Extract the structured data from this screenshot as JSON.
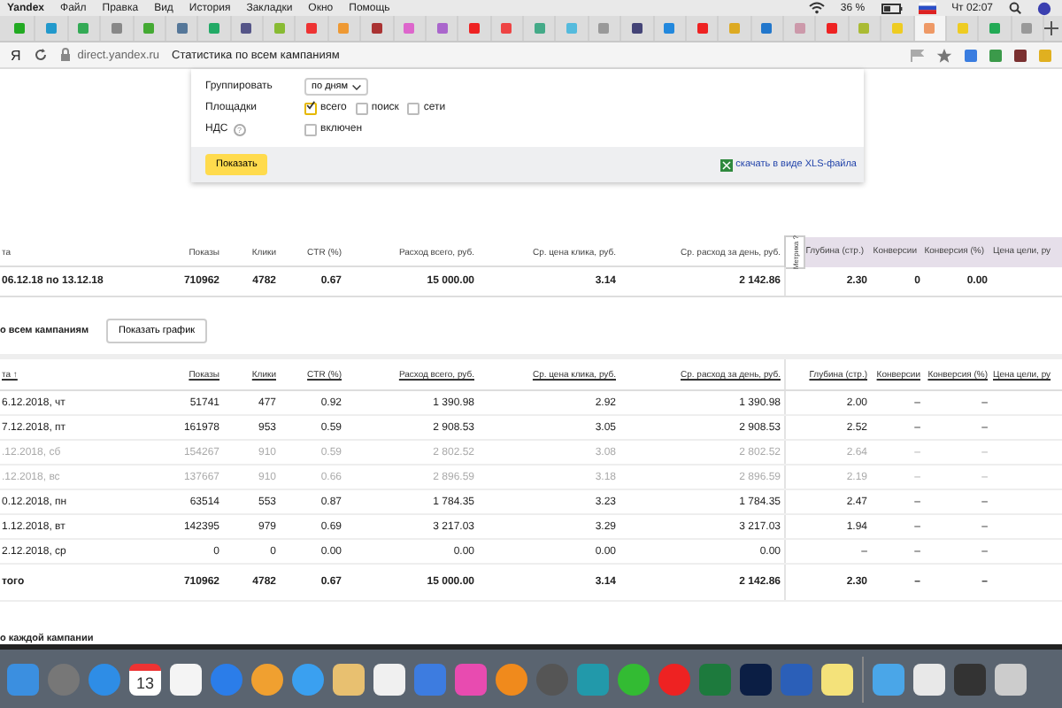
{
  "menu_bar": {
    "app": "Yandex",
    "items": [
      "Файл",
      "Правка",
      "Вид",
      "История",
      "Закладки",
      "Окно",
      "Помощь"
    ],
    "battery": "36 %",
    "clock": "Чт 02:07"
  },
  "address_bar": {
    "logo": "Я",
    "url": "direct.yandex.ru",
    "page_title": "Статистика по всем кампаниям"
  },
  "filter_form": {
    "group_label": "Группировать",
    "group_value": "по дням",
    "sites_label": "Площадки",
    "sites": [
      {
        "label": "всего",
        "checked": true
      },
      {
        "label": "поиск",
        "checked": false
      },
      {
        "label": "сети",
        "checked": false
      }
    ],
    "vat_label": "НДС",
    "vat_help": "?",
    "vat": {
      "label": "включен",
      "checked": false
    },
    "submit": "Показать",
    "download_link": "скачать в виде XLS-файла"
  },
  "summary_table": {
    "columns": [
      "та",
      "Показы",
      "Клики",
      "CTR (%)",
      "Расход всего, руб.",
      "Ср. цена клика, руб.",
      "Ср. расход за день, руб.",
      "Глубина (стр.)",
      "Конверсии",
      "Конверсия (%)",
      "Цена цели, ру"
    ],
    "metrika_tab": "Метрика ?",
    "rows": [
      [
        "06.12.18 по 13.12.18",
        "710962",
        "4782",
        "0.67",
        "15 000.00",
        "3.14",
        "2 142.86",
        "2.30",
        "0",
        "0.00"
      ]
    ]
  },
  "all_campaigns": {
    "heading": "о всем кампаниям",
    "chart_button": "Показать график"
  },
  "daily_table": {
    "columns": [
      "та ↑",
      "Показы",
      "Клики",
      "CTR (%)",
      "Расход всего, руб.",
      "Ср. цена клика, руб.",
      "Ср. расход за день, руб.",
      "Глубина (стр.)",
      "Конверсии",
      "Конверсия (%)",
      "Цена цели, ру"
    ],
    "rows": [
      {
        "muted": false,
        "cells": [
          "6.12.2018, чт",
          "51741",
          "477",
          "0.92",
          "1 390.98",
          "2.92",
          "1 390.98",
          "2.00",
          "–",
          "–"
        ]
      },
      {
        "muted": false,
        "cells": [
          "7.12.2018, пт",
          "161978",
          "953",
          "0.59",
          "2 908.53",
          "3.05",
          "2 908.53",
          "2.52",
          "–",
          "–"
        ]
      },
      {
        "muted": true,
        "cells": [
          ".12.2018, сб",
          "154267",
          "910",
          "0.59",
          "2 802.52",
          "3.08",
          "2 802.52",
          "2.64",
          "–",
          "–"
        ]
      },
      {
        "muted": true,
        "cells": [
          ".12.2018, вс",
          "137667",
          "910",
          "0.66",
          "2 896.59",
          "3.18",
          "2 896.59",
          "2.19",
          "–",
          "–"
        ]
      },
      {
        "muted": false,
        "cells": [
          "0.12.2018, пн",
          "63514",
          "553",
          "0.87",
          "1 784.35",
          "3.23",
          "1 784.35",
          "2.47",
          "–",
          "–"
        ]
      },
      {
        "muted": false,
        "cells": [
          "1.12.2018, вт",
          "142395",
          "979",
          "0.69",
          "3 217.03",
          "3.29",
          "3 217.03",
          "1.94",
          "–",
          "–"
        ]
      },
      {
        "muted": false,
        "cells": [
          "2.12.2018, ср",
          "0",
          "0",
          "0.00",
          "0.00",
          "0.00",
          "0.00",
          "–",
          "–",
          "–"
        ]
      }
    ],
    "total": [
      "того",
      "710962",
      "4782",
      "0.67",
      "15 000.00",
      "3.14",
      "2 142.86",
      "2.30",
      "–",
      "–"
    ]
  },
  "each_campaign_heading": "о каждой кампании",
  "dock": {
    "calendar_day": "13"
  }
}
